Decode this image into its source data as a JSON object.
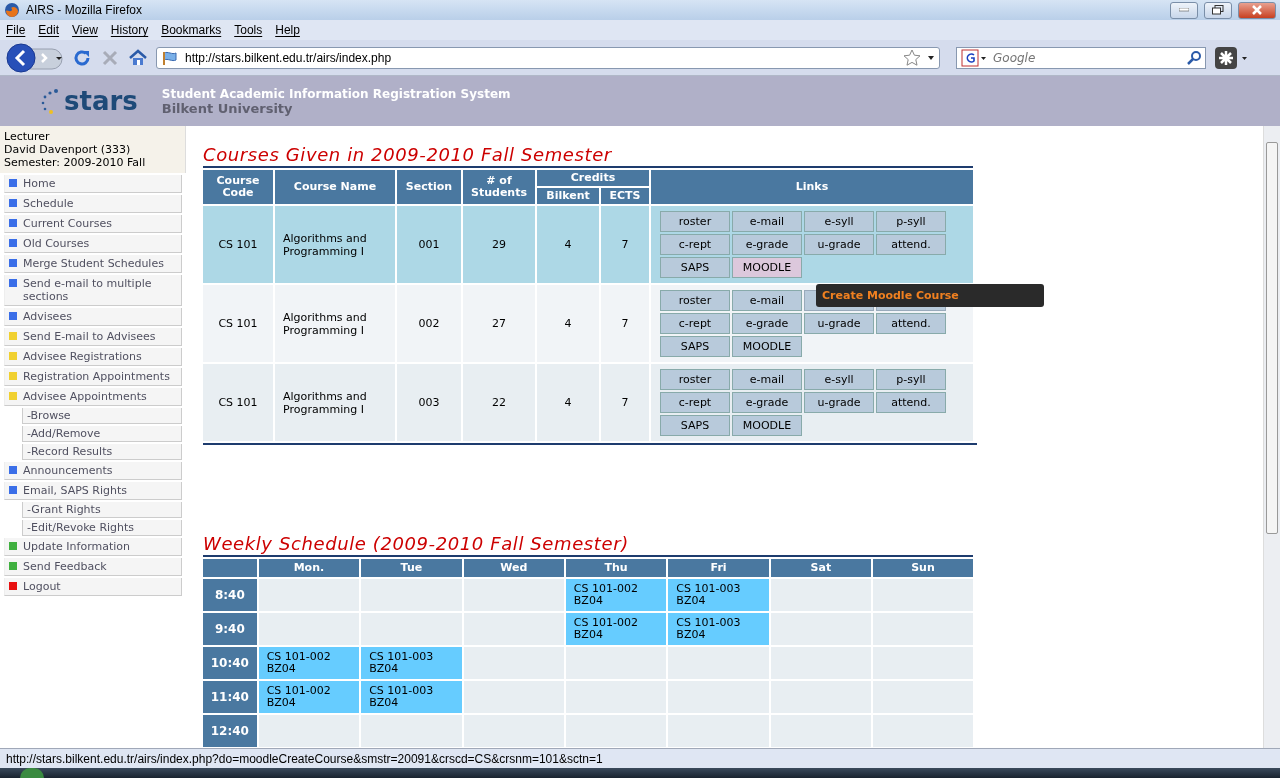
{
  "window": {
    "title": "AIRS - Mozilla Firefox"
  },
  "menu": [
    "File",
    "Edit",
    "View",
    "History",
    "Bookmarks",
    "Tools",
    "Help"
  ],
  "address": {
    "value": "http://stars.bilkent.edu.tr/airs/index.php"
  },
  "search": {
    "placeholder": "Google"
  },
  "site": {
    "logo": "stars",
    "title": "Student Academic Information Registration System",
    "subtitle": "Bilkent University"
  },
  "user": {
    "role": "Lecturer",
    "name": "David Davenport (333)",
    "semester": "Semester: 2009-2010 Fall"
  },
  "sidebar": {
    "items": [
      {
        "label": "Home",
        "color": "#3a6ee8"
      },
      {
        "label": "Schedule",
        "color": "#3a6ee8"
      },
      {
        "label": "Current Courses",
        "color": "#3a6ee8"
      },
      {
        "label": "Old Courses",
        "color": "#3a6ee8"
      },
      {
        "label": "Merge Student Schedules",
        "color": "#3a6ee8"
      },
      {
        "label": "Send e-mail to multiple sections",
        "color": "#3a6ee8"
      },
      {
        "label": "Advisees",
        "color": "#3a6ee8"
      },
      {
        "label": "Send E-mail to Advisees",
        "color": "#f0d030"
      },
      {
        "label": "Advisee Registrations",
        "color": "#f0d030"
      },
      {
        "label": "Registration Appointments",
        "color": "#f0d030"
      },
      {
        "label": "Advisee Appointments",
        "color": "#f0d030",
        "children": [
          {
            "label": "-Browse"
          },
          {
            "label": "-Add/Remove"
          },
          {
            "label": "-Record Results"
          }
        ]
      },
      {
        "label": "Announcements",
        "color": "#3a6ee8"
      },
      {
        "label": "Email, SAPS Rights",
        "color": "#3a6ee8",
        "children": [
          {
            "label": "-Grant Rights"
          },
          {
            "label": "-Edit/Revoke Rights"
          }
        ]
      },
      {
        "label": "Update Information",
        "color": "#40b040"
      },
      {
        "label": "Send Feedback",
        "color": "#40b040"
      },
      {
        "label": "Logout",
        "color": "#e81010"
      }
    ]
  },
  "courses": {
    "title": "Courses Given in 2009-2010 Fall Semester",
    "columns": [
      "Course Code",
      "Course Name",
      "Section",
      "# of Students",
      "Credits",
      "Bilkent",
      "ECTS",
      "Links"
    ],
    "rows": [
      {
        "selected": true,
        "code": "CS 101",
        "name": "Algorithms and Programming I",
        "section": "001",
        "students": "29",
        "bilkent": "4",
        "ects": "7",
        "links": [
          {
            "kind": "button",
            "label": "roster",
            "highlighted": false
          },
          {
            "kind": "button",
            "label": "e-mail",
            "highlighted": false
          },
          {
            "kind": "button",
            "label": "e-syll",
            "highlighted": false
          },
          {
            "kind": "button",
            "label": "p-syll",
            "highlighted": false
          },
          {
            "kind": "button",
            "label": "c-rept",
            "highlighted": false
          },
          {
            "kind": "button",
            "label": "e-grade",
            "highlighted": false
          },
          {
            "kind": "button",
            "label": "u-grade",
            "highlighted": false
          },
          {
            "kind": "button",
            "label": "attend.",
            "highlighted": false
          },
          {
            "kind": "button",
            "label": "SAPS",
            "highlighted": false
          },
          {
            "kind": "button",
            "label": "MOODLE",
            "highlighted": true
          }
        ]
      },
      {
        "selected": false,
        "code": "CS 101",
        "name": "Algorithms and Programming I",
        "section": "002",
        "students": "27",
        "bilkent": "4",
        "ects": "7",
        "tooltip": "Create Moodle Course",
        "links": [
          {
            "kind": "button",
            "label": "roster",
            "highlighted": false
          },
          {
            "kind": "button",
            "label": "e-mail",
            "highlighted": false
          },
          {
            "kind": "covered",
            "highlighted": false
          },
          {
            "kind": "covered",
            "highlighted": false
          },
          {
            "kind": "button",
            "label": "c-rept",
            "highlighted": false
          },
          {
            "kind": "button",
            "label": "e-grade",
            "highlighted": false
          },
          {
            "kind": "button",
            "label": "u-grade",
            "highlighted": false
          },
          {
            "kind": "button",
            "label": "attend.",
            "highlighted": false
          },
          {
            "kind": "button",
            "label": "SAPS",
            "highlighted": false
          },
          {
            "kind": "button",
            "label": "MOODLE",
            "highlighted": false
          }
        ]
      },
      {
        "selected": false,
        "code": "CS 101",
        "name": "Algorithms and Programming I",
        "section": "003",
        "students": "22",
        "bilkent": "4",
        "ects": "7",
        "links": [
          {
            "kind": "button",
            "label": "roster",
            "highlighted": false
          },
          {
            "kind": "button",
            "label": "e-mail",
            "highlighted": false
          },
          {
            "kind": "button",
            "label": "e-syll",
            "highlighted": false
          },
          {
            "kind": "button",
            "label": "p-syll",
            "highlighted": false
          },
          {
            "kind": "button",
            "label": "c-rept",
            "highlighted": false
          },
          {
            "kind": "button",
            "label": "e-grade",
            "highlighted": false
          },
          {
            "kind": "button",
            "label": "u-grade",
            "highlighted": false
          },
          {
            "kind": "button",
            "label": "attend.",
            "highlighted": false
          },
          {
            "kind": "button",
            "label": "SAPS",
            "highlighted": false
          },
          {
            "kind": "button",
            "label": "MOODLE",
            "highlighted": false
          }
        ]
      }
    ]
  },
  "schedule": {
    "title": "Weekly Schedule (2009-2010 Fall Semester)",
    "days": [
      "Mon.",
      "Tue",
      "Wed",
      "Thu",
      "Fri",
      "Sat",
      "Sun"
    ],
    "rows": [
      {
        "time": "8:40",
        "cells": [
          null,
          null,
          null,
          {
            "course": "CS 101-002",
            "room": "BZ04"
          },
          {
            "course": "CS 101-003",
            "room": "BZ04"
          },
          null,
          null
        ]
      },
      {
        "time": "9:40",
        "cells": [
          null,
          null,
          null,
          {
            "course": "CS 101-002",
            "room": "BZ04"
          },
          {
            "course": "CS 101-003",
            "room": "BZ04"
          },
          null,
          null
        ]
      },
      {
        "time": "10:40",
        "cells": [
          {
            "course": "CS 101-002",
            "room": "BZ04"
          },
          {
            "course": "CS 101-003",
            "room": "BZ04"
          },
          null,
          null,
          null,
          null,
          null
        ]
      },
      {
        "time": "11:40",
        "cells": [
          {
            "course": "CS 101-002",
            "room": "BZ04"
          },
          {
            "course": "CS 101-003",
            "room": "BZ04"
          },
          null,
          null,
          null,
          null,
          null
        ]
      },
      {
        "time": "12:40",
        "cells": [
          null,
          null,
          null,
          null,
          null,
          null,
          null
        ]
      }
    ]
  },
  "status_bar": {
    "text": "http://stars.bilkent.edu.tr/airs/index.php?do=moodleCreateCourse&smstr=20091&crscd=CS&crsnm=101&sctn=1"
  }
}
